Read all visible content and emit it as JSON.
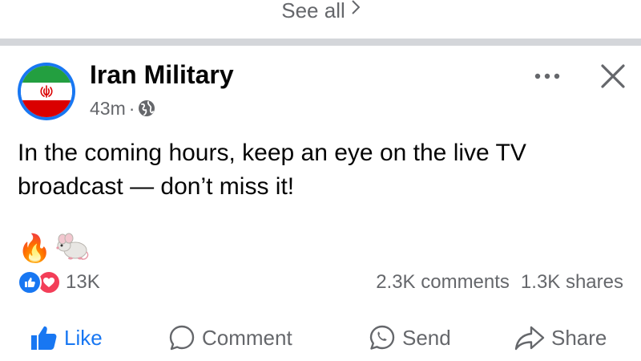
{
  "feed": {
    "see_all_label": "See all"
  },
  "post": {
    "author": "Iran Military",
    "timestamp": "43m",
    "separator": "·",
    "audience_icon": "globe-icon",
    "text": "In the coming hours, keep an eye on the live TV broadcast — don’t miss it!",
    "emojis": [
      "🔥",
      "🐁"
    ],
    "reactions": {
      "types": [
        "like",
        "love"
      ],
      "count": "13K"
    },
    "comments_count": "2.3K comments",
    "shares_count": "1.3K shares",
    "actions": {
      "like": "Like",
      "comment": "Comment",
      "send": "Send",
      "share": "Share"
    },
    "colors": {
      "accent": "#1877f2",
      "love": "#f33e58",
      "secondary_text": "#65676b",
      "flag_green": "#239f40",
      "flag_red": "#da0000"
    }
  }
}
